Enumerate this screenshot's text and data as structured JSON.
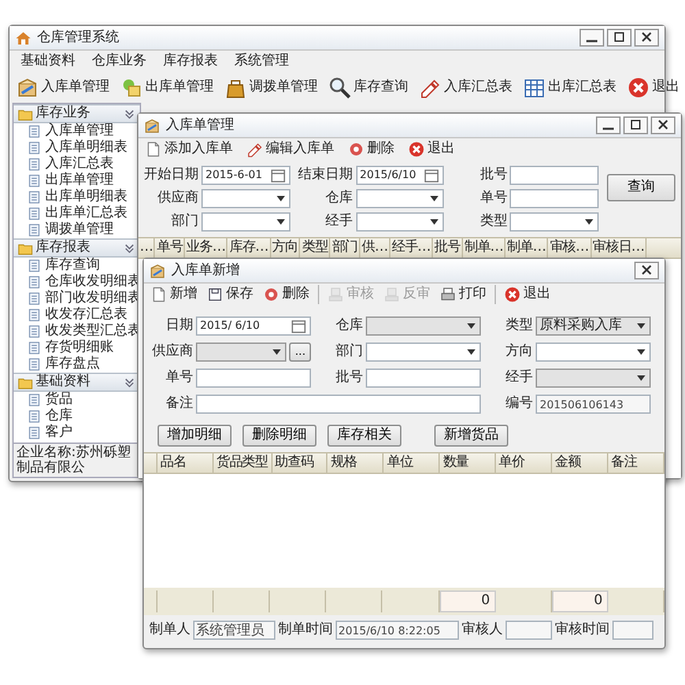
{
  "main_window": {
    "title": "仓库管理系统",
    "menu": [
      "基础资料",
      "仓库业务",
      "库存报表",
      "系统管理"
    ],
    "toolbar": [
      "入库单管理",
      "出库单管理",
      "调拨单管理",
      "库存查询",
      "入库汇总表",
      "出库汇总表",
      "退出"
    ],
    "sidebar": [
      {
        "title": "库存业务",
        "items": [
          "入库单管理",
          "入库单明细表",
          "入库汇总表",
          "出库单管理",
          "出库单明细表",
          "出库单汇总表",
          "调拨单管理"
        ]
      },
      {
        "title": "库存报表",
        "items": [
          "库存查询",
          "仓库收发明细表",
          "部门收发明细表",
          "收发存汇总表",
          "收发类型汇总表",
          "存货明细账",
          "库存盘点"
        ]
      },
      {
        "title": "基础资料",
        "items": [
          "货品",
          "仓库",
          "客户"
        ]
      }
    ],
    "status_bar": "企业名称:苏州砾塑制品有限公"
  },
  "list_window": {
    "title": "入库单管理",
    "toolbar": [
      "添加入库单",
      "编辑入库单",
      "删除",
      "退出"
    ],
    "filters": [
      {
        "label": "开始日期",
        "kind": "date",
        "value": "2015-6-01"
      },
      {
        "label": "结束日期",
        "kind": "date",
        "value": "2015/6/10"
      },
      {
        "label": "批号",
        "kind": "text"
      },
      {
        "label": "供应商",
        "kind": "select"
      },
      {
        "label": "仓库",
        "kind": "select"
      },
      {
        "label": "单号",
        "kind": "text"
      },
      {
        "label": "部门",
        "kind": "select"
      },
      {
        "label": "经手",
        "kind": "select"
      },
      {
        "label": "类型",
        "kind": "select"
      }
    ],
    "search_button": "查询",
    "columns": [
      "…",
      "单号",
      "业务…",
      "库存…",
      "方向",
      "类型",
      "部门",
      "供…",
      "经手…",
      "批号",
      "制单…",
      "制单…",
      "审核…",
      "审核日…"
    ]
  },
  "edit_window": {
    "title": "入库单新增",
    "toolbar": [
      [
        {
          "label": "新增",
          "disabled": false
        },
        {
          "label": "保存",
          "disabled": false
        },
        {
          "label": "删除",
          "disabled": false
        }
      ],
      [
        {
          "label": "审核",
          "disabled": true
        },
        {
          "label": "反审",
          "disabled": true
        },
        {
          "label": "打印",
          "disabled": false
        }
      ],
      [
        {
          "label": "退出",
          "disabled": false
        }
      ]
    ],
    "fields": [
      {
        "label": "日期",
        "kind": "date",
        "value": "2015/ 6/10"
      },
      {
        "label": "仓库",
        "kind": "combo"
      },
      {
        "label": "类型",
        "kind": "combo",
        "value": "原料采购入库"
      },
      {
        "label": "供应商",
        "kind": "lookup",
        "button": "..."
      },
      {
        "label": "部门",
        "kind": "select"
      },
      {
        "label": "方向",
        "kind": "select"
      },
      {
        "label": "单号",
        "kind": "text"
      },
      {
        "label": "批号",
        "kind": "text"
      },
      {
        "label": "经手",
        "kind": "combo"
      },
      {
        "label": "备注",
        "kind": "wide"
      },
      {
        "label": "编号",
        "kind": "readonly",
        "value": "201506106143"
      }
    ],
    "buttons": [
      "增加明细",
      "删除明细",
      "库存相关",
      "新增货品"
    ],
    "columns": [
      {
        "label": "品名"
      },
      {
        "label": "货品类型"
      },
      {
        "label": "助查码"
      },
      {
        "label": "规格"
      },
      {
        "label": "单位"
      },
      {
        "label": "数量",
        "total": "0"
      },
      {
        "label": "单价"
      },
      {
        "label": "金额",
        "total": "0"
      },
      {
        "label": "备注"
      }
    ],
    "footer": [
      {
        "label": "制单人",
        "value": "系统管理员"
      },
      {
        "label": "制单时间",
        "value": "2015/6/10 8:22:05"
      },
      {
        "label": "审核人"
      },
      {
        "label": "审核时间"
      }
    ]
  }
}
